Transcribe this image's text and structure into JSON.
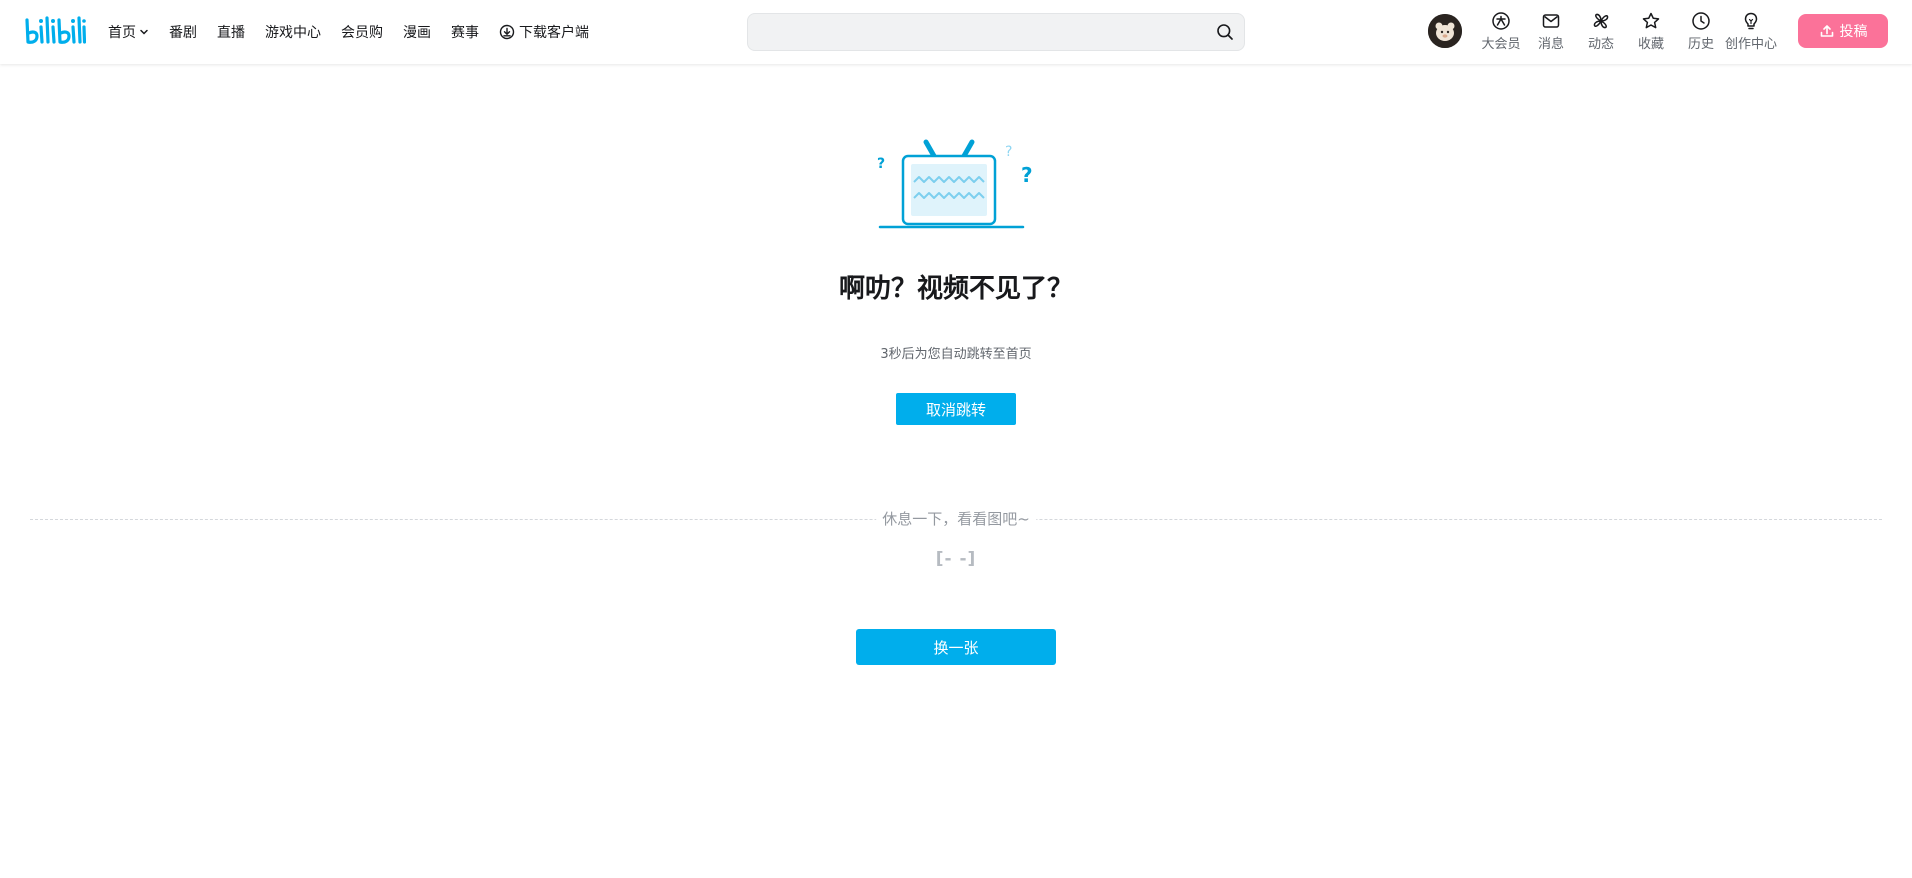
{
  "header": {
    "logo_label": "bilibili",
    "nav": [
      {
        "label": "首页"
      },
      {
        "label": "番剧"
      },
      {
        "label": "直播"
      },
      {
        "label": "游戏中心"
      },
      {
        "label": "会员购"
      },
      {
        "label": "漫画"
      },
      {
        "label": "赛事"
      },
      {
        "label": "下载客户端"
      }
    ],
    "search": {
      "placeholder": "",
      "value": ""
    },
    "entries": [
      {
        "label": "大会员",
        "icon": "vip-icon"
      },
      {
        "label": "消息",
        "icon": "message-icon"
      },
      {
        "label": "动态",
        "icon": "dynamic-icon"
      },
      {
        "label": "收藏",
        "icon": "star-icon"
      },
      {
        "label": "历史",
        "icon": "clock-icon"
      },
      {
        "label": "创作中心",
        "icon": "lightbulb-icon"
      }
    ],
    "upload_label": "投稿"
  },
  "main": {
    "title": "啊叻？视频不见了？",
    "redirect_tip": "3秒后为您自动跳转至首页",
    "cancel_label": "取消跳转",
    "divider_text": "休息一下，看看图吧~",
    "emoticon": "[- -]",
    "change_label": "换一张"
  },
  "colors": {
    "brand_blue": "#00aeec",
    "upload_pink": "#fb7299",
    "text_primary": "#18191c",
    "text_secondary": "#61666d",
    "text_muted": "#9499a0"
  }
}
